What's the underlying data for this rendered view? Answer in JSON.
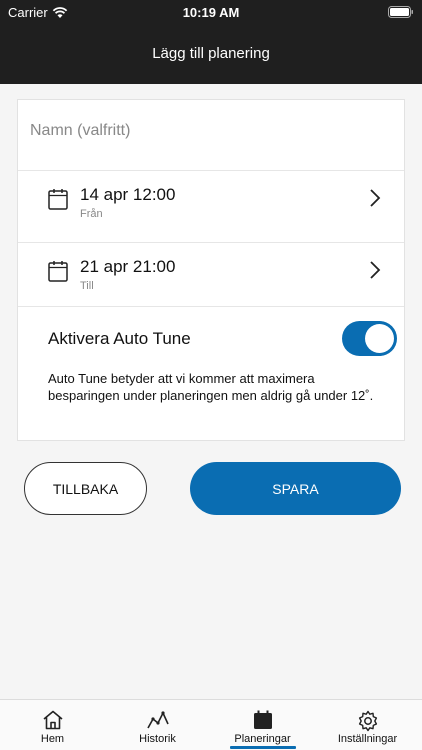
{
  "status_bar": {
    "carrier": "Carrier",
    "time": "10:19 AM"
  },
  "header": {
    "title": "Lägg till planering"
  },
  "form": {
    "name_placeholder": "Namn (valfritt)",
    "from": {
      "date": "14 apr 12:00",
      "label": "Från"
    },
    "to": {
      "date": "21 apr 21:00",
      "label": "Till"
    },
    "auto_tune": {
      "label": "Aktivera Auto Tune",
      "enabled": true,
      "description": "Auto Tune betyder att vi kommer att maximera besparingen under planeringen men aldrig gå under 12˚."
    }
  },
  "buttons": {
    "back": "TILLBAKA",
    "save": "SPARA"
  },
  "tabs": [
    {
      "label": "Hem",
      "icon": "home-icon"
    },
    {
      "label": "Historik",
      "icon": "history-icon"
    },
    {
      "label": "Planeringar",
      "icon": "calendar-icon",
      "active": true
    },
    {
      "label": "Inställningar",
      "icon": "gear-icon"
    }
  ],
  "colors": {
    "accent": "#0a6db2",
    "header_bg": "#1f1f1f"
  }
}
